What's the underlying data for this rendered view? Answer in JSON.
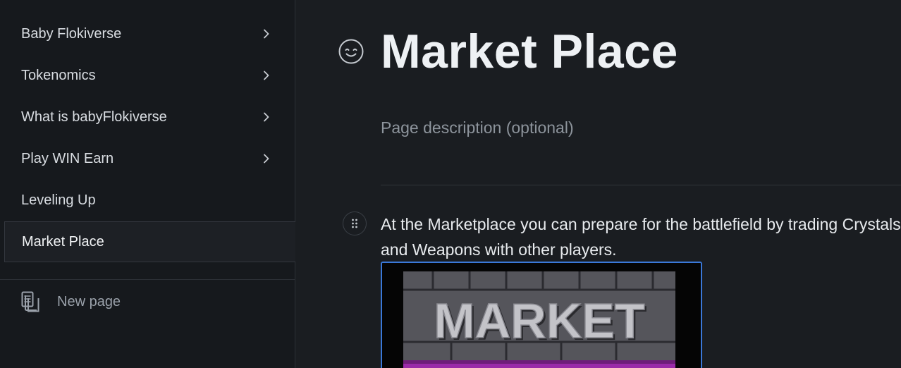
{
  "sidebar": {
    "items": [
      {
        "label": "Baby Flokiverse",
        "has_children": true
      },
      {
        "label": "Tokenomics",
        "has_children": true
      },
      {
        "label": "What is babyFlokiverse",
        "has_children": true
      },
      {
        "label": "Play WIN Earn",
        "has_children": true
      },
      {
        "label": "Leveling Up",
        "has_children": false
      },
      {
        "label": "Market Place",
        "has_children": false,
        "active": true
      }
    ],
    "new_page_label": "New page"
  },
  "page": {
    "title": "Market Place",
    "description_placeholder": "Page description (optional)",
    "body_text": "At the Marketplace you can prepare for the battlefield by trading Crystals and Weapons with other players.",
    "image": {
      "text": "MARKET"
    }
  },
  "colors": {
    "background": "#1a1d21",
    "sidebar": "#16191d",
    "selection_border": "#3a78d8",
    "image_purple": "#9a2aa8"
  }
}
